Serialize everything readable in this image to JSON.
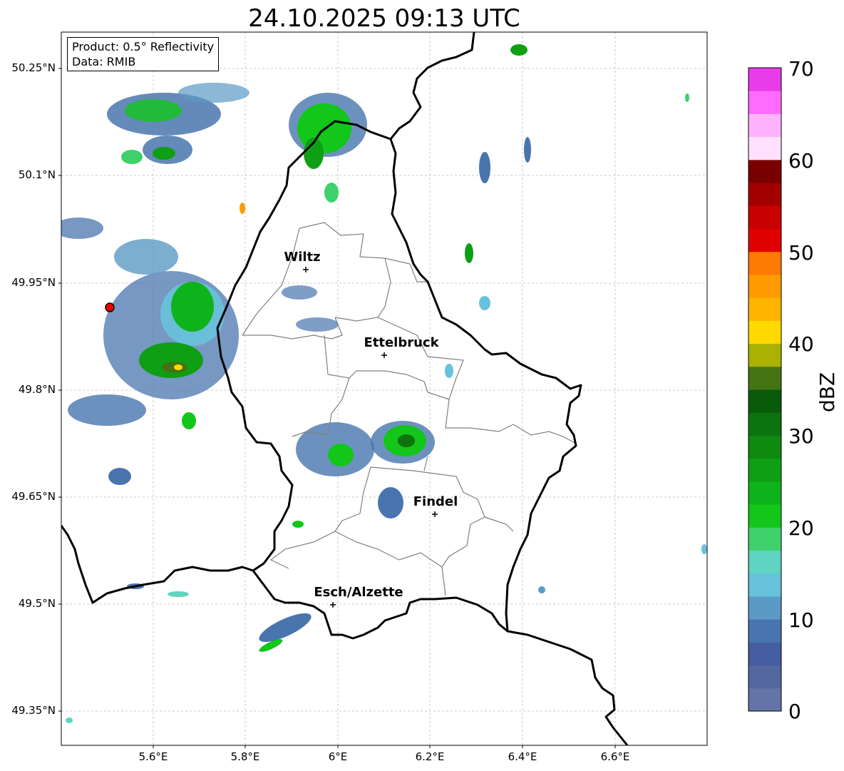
{
  "title": "24.10.2025 09:13 UTC",
  "info_box": {
    "product": "Product: 0.5° Reflectivity",
    "data": "Data: RMIB"
  },
  "axes": {
    "lat_labels": [
      "50.25°N",
      "50.1°N",
      "49.95°N",
      "49.8°N",
      "49.65°N",
      "49.5°N",
      "49.35°N"
    ],
    "lon_labels": [
      "5.6°E",
      "5.8°E",
      "6°E",
      "6.2°E",
      "6.4°E",
      "6.6°E"
    ]
  },
  "cities": [
    {
      "name": "Wiltz"
    },
    {
      "name": "Ettelbruck"
    },
    {
      "name": "Findel"
    },
    {
      "name": "Esch/Alzette"
    }
  ],
  "colorbar": {
    "label": "dBZ",
    "ticks": [
      "0",
      "10",
      "20",
      "30",
      "40",
      "50",
      "60",
      "70"
    ],
    "colors": [
      "#6474a7",
      "#55679f",
      "#455da1",
      "#4975ae",
      "#5b9ac4",
      "#67c2db",
      "#5fd4c0",
      "#3fd16b",
      "#12c61a",
      "#0eb31c",
      "#0e9f15",
      "#0d8b0e",
      "#0d730f",
      "#0a5a0c",
      "#447311",
      "#aab100",
      "#ffd900",
      "#ffb400",
      "#ff9a00",
      "#ff7a00",
      "#e10000",
      "#c80000",
      "#a30000",
      "#7a0000",
      "#ffe1ff",
      "#ffb3ff",
      "#ff6bff",
      "#e93ce9"
    ]
  },
  "colors": {
    "gridline": "#bbbbbb",
    "border": "#000000",
    "canton": "#808080",
    "radar_site": "#e60000"
  }
}
